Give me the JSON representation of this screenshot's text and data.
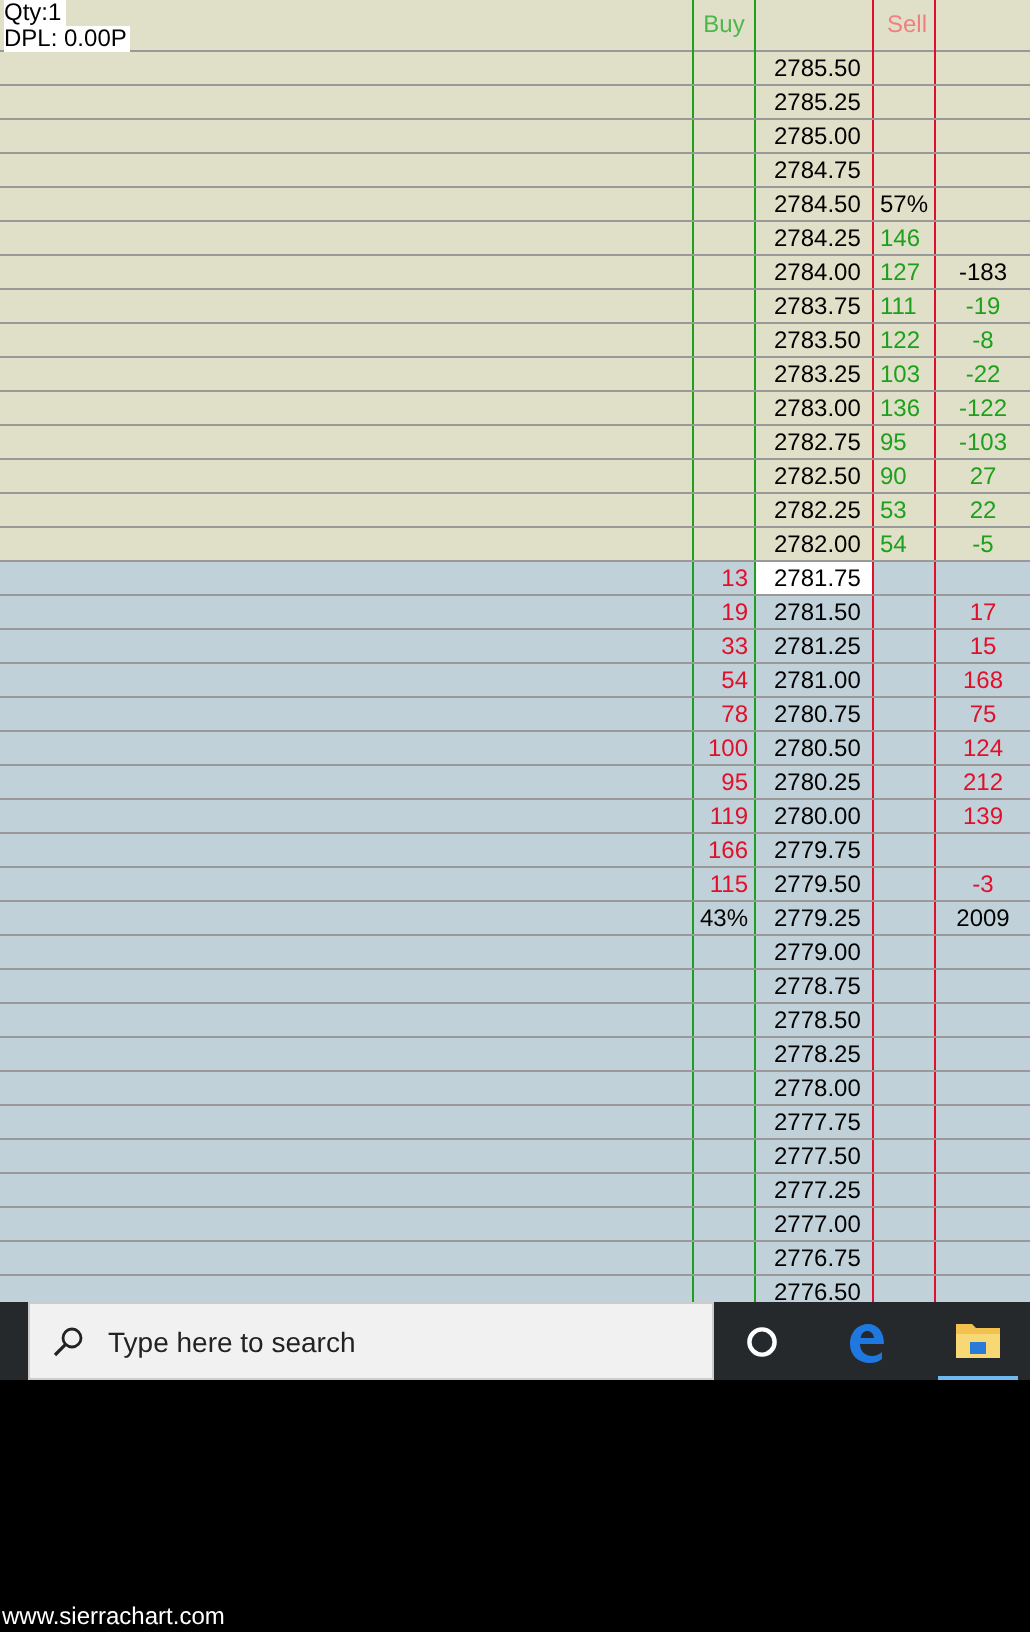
{
  "overlay": {
    "qty": "Qty:1",
    "dpl": "DPL: 0.00P"
  },
  "headers": {
    "buy": "Buy",
    "sell": "Sell"
  },
  "rows": [
    {
      "kind": "ask",
      "price": "2785.50",
      "current": false
    },
    {
      "kind": "ask",
      "price": "2785.25",
      "current": false
    },
    {
      "kind": "ask",
      "price": "2785.00",
      "current": false
    },
    {
      "kind": "ask",
      "price": "2784.75",
      "current": false
    },
    {
      "kind": "ask",
      "price": "2784.50",
      "current": false,
      "sell": {
        "text": "57%",
        "color": "#000000"
      }
    },
    {
      "kind": "ask",
      "price": "2784.25",
      "current": false,
      "sell": {
        "text": "146",
        "color": "#1ea01e"
      }
    },
    {
      "kind": "ask",
      "price": "2784.00",
      "current": false,
      "sell": {
        "text": "127",
        "color": "#1ea01e"
      },
      "delta": {
        "text": "-183",
        "color": "#000000"
      }
    },
    {
      "kind": "ask",
      "price": "2783.75",
      "current": false,
      "sell": {
        "text": "111",
        "color": "#1ea01e"
      },
      "delta": {
        "text": "-19",
        "color": "#1ea01e"
      }
    },
    {
      "kind": "ask",
      "price": "2783.50",
      "current": false,
      "sell": {
        "text": "122",
        "color": "#1ea01e"
      },
      "delta": {
        "text": "-8",
        "color": "#1ea01e"
      }
    },
    {
      "kind": "ask",
      "price": "2783.25",
      "current": false,
      "sell": {
        "text": "103",
        "color": "#1ea01e"
      },
      "delta": {
        "text": "-22",
        "color": "#1ea01e"
      }
    },
    {
      "kind": "ask",
      "price": "2783.00",
      "current": false,
      "sell": {
        "text": "136",
        "color": "#1ea01e"
      },
      "delta": {
        "text": "-122",
        "color": "#1ea01e"
      }
    },
    {
      "kind": "ask",
      "price": "2782.75",
      "current": false,
      "sell": {
        "text": "95",
        "color": "#1ea01e"
      },
      "delta": {
        "text": "-103",
        "color": "#1ea01e"
      }
    },
    {
      "kind": "ask",
      "price": "2782.50",
      "current": false,
      "sell": {
        "text": "90",
        "color": "#1ea01e"
      },
      "delta": {
        "text": "27",
        "color": "#1ea01e"
      }
    },
    {
      "kind": "ask",
      "price": "2782.25",
      "current": false,
      "sell": {
        "text": "53",
        "color": "#1ea01e"
      },
      "delta": {
        "text": "22",
        "color": "#1ea01e"
      }
    },
    {
      "kind": "ask",
      "price": "2782.00",
      "current": false,
      "sell": {
        "text": "54",
        "color": "#1ea01e"
      },
      "delta": {
        "text": "-5",
        "color": "#1ea01e"
      }
    },
    {
      "kind": "bid",
      "price": "2781.75",
      "current": true,
      "buy": {
        "text": "13",
        "color": "#e0102a"
      }
    },
    {
      "kind": "bid",
      "price": "2781.50",
      "current": false,
      "buy": {
        "text": "19",
        "color": "#e0102a"
      },
      "delta": {
        "text": "17",
        "color": "#e0102a"
      }
    },
    {
      "kind": "bid",
      "price": "2781.25",
      "current": false,
      "buy": {
        "text": "33",
        "color": "#e0102a"
      },
      "delta": {
        "text": "15",
        "color": "#e0102a"
      }
    },
    {
      "kind": "bid",
      "price": "2781.00",
      "current": false,
      "buy": {
        "text": "54",
        "color": "#e0102a"
      },
      "delta": {
        "text": "168",
        "color": "#e0102a"
      }
    },
    {
      "kind": "bid",
      "price": "2780.75",
      "current": false,
      "buy": {
        "text": "78",
        "color": "#e0102a"
      },
      "delta": {
        "text": "75",
        "color": "#e0102a"
      }
    },
    {
      "kind": "bid",
      "price": "2780.50",
      "current": false,
      "buy": {
        "text": "100",
        "color": "#e0102a"
      },
      "delta": {
        "text": "124",
        "color": "#e0102a"
      }
    },
    {
      "kind": "bid",
      "price": "2780.25",
      "current": false,
      "buy": {
        "text": "95",
        "color": "#e0102a"
      },
      "delta": {
        "text": "212",
        "color": "#e0102a"
      }
    },
    {
      "kind": "bid",
      "price": "2780.00",
      "current": false,
      "buy": {
        "text": "119",
        "color": "#e0102a"
      },
      "delta": {
        "text": "139",
        "color": "#e0102a"
      }
    },
    {
      "kind": "bid",
      "price": "2779.75",
      "current": false,
      "buy": {
        "text": "166",
        "color": "#e0102a"
      }
    },
    {
      "kind": "bid",
      "price": "2779.50",
      "current": false,
      "buy": {
        "text": "115",
        "color": "#e0102a"
      },
      "delta": {
        "text": "-3",
        "color": "#e0102a"
      }
    },
    {
      "kind": "bid",
      "price": "2779.25",
      "current": false,
      "buy": {
        "text": "43%",
        "color": "#000000"
      },
      "delta": {
        "text": "2009",
        "color": "#000000"
      }
    },
    {
      "kind": "bid",
      "price": "2779.00",
      "current": false
    },
    {
      "kind": "bid",
      "price": "2778.75",
      "current": false
    },
    {
      "kind": "bid",
      "price": "2778.50",
      "current": false
    },
    {
      "kind": "bid",
      "price": "2778.25",
      "current": false
    },
    {
      "kind": "bid",
      "price": "2778.00",
      "current": false
    },
    {
      "kind": "bid",
      "price": "2777.75",
      "current": false
    },
    {
      "kind": "bid",
      "price": "2777.50",
      "current": false
    },
    {
      "kind": "bid",
      "price": "2777.25",
      "current": false
    },
    {
      "kind": "bid",
      "price": "2777.00",
      "current": false
    },
    {
      "kind": "bid",
      "price": "2776.75",
      "current": false
    },
    {
      "kind": "bid",
      "price": "2776.50",
      "current": false
    }
  ],
  "taskbar": {
    "search_placeholder": "Type here to search"
  },
  "footer": "www.sierrachart.com"
}
